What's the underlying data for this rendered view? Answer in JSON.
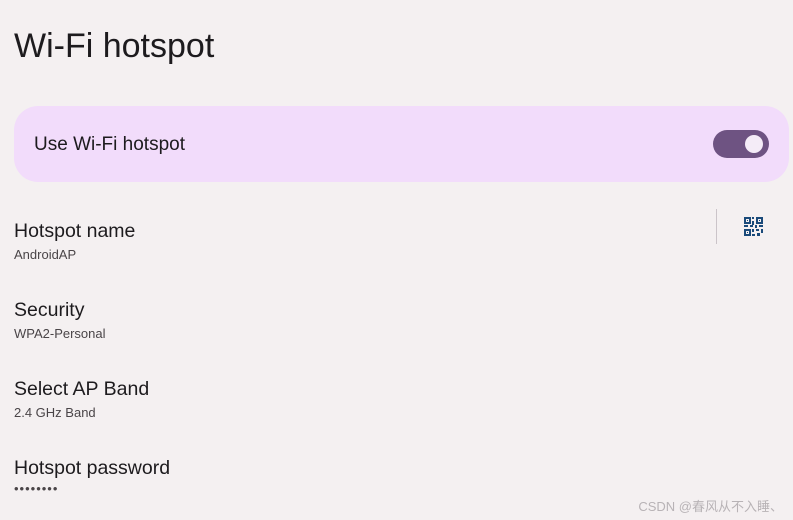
{
  "header": {
    "title": "Wi-Fi hotspot"
  },
  "master_switch": {
    "label": "Use Wi-Fi hotspot",
    "checked": true
  },
  "preferences": {
    "hotspot_name": {
      "title": "Hotspot name",
      "summary": "AndroidAP",
      "action_icon": "qr-code-icon"
    },
    "security": {
      "title": "Security",
      "summary": "WPA2-Personal"
    },
    "ap_band": {
      "title": "Select AP Band",
      "summary": "2.4 GHz Band"
    },
    "password": {
      "title": "Hotspot password",
      "summary": "••••••••"
    }
  },
  "watermark": "CSDN @春风从不入睡、",
  "colors": {
    "background": "#f4f0f1",
    "master_card": "#f2dcfb",
    "switch_track": "#6e5382",
    "switch_thumb": "#f4ecf7",
    "qr_icon": "#1a4a7a"
  }
}
